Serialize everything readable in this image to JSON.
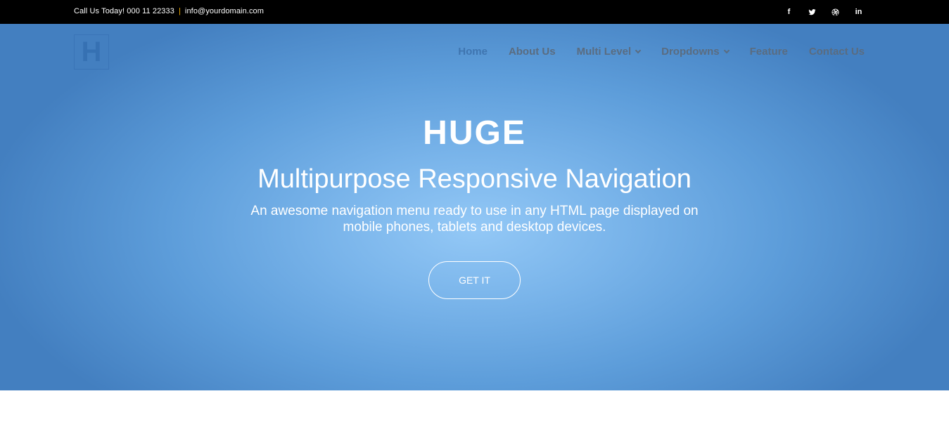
{
  "topbar": {
    "phone": "Call Us Today! 000 11 22333",
    "separator": "|",
    "email": "info@yourdomain.com",
    "social": [
      {
        "icon": "facebook-icon",
        "glyph": "f"
      },
      {
        "icon": "twitter-icon",
        "glyph": ""
      },
      {
        "icon": "dribbble-icon",
        "glyph": ""
      },
      {
        "icon": "linkedin-icon",
        "glyph": "in"
      }
    ]
  },
  "logo": {
    "letter": "H"
  },
  "nav": {
    "items": [
      {
        "label": "Home",
        "active": true
      },
      {
        "label": "About Us"
      },
      {
        "label": "Multi Level",
        "dropdown": true
      },
      {
        "label": "Dropdowns",
        "dropdown": true
      },
      {
        "label": "Feature"
      },
      {
        "label": "Contact Us"
      }
    ]
  },
  "hero": {
    "title": "HUGE",
    "subtitle": "Multipurpose Responsive Navigation",
    "description_line1": "An awesome navigation menu ready to use in any HTML page displayed on",
    "description_line2": "mobile phones, tablets and desktop devices.",
    "cta_label": "GET IT"
  },
  "colors": {
    "topbar_bg": "#000000",
    "hero_center": "#93c8f6",
    "hero_edge": "#437fc0",
    "nav_text": "#5a6c80",
    "nav_active": "#3f75b0"
  }
}
